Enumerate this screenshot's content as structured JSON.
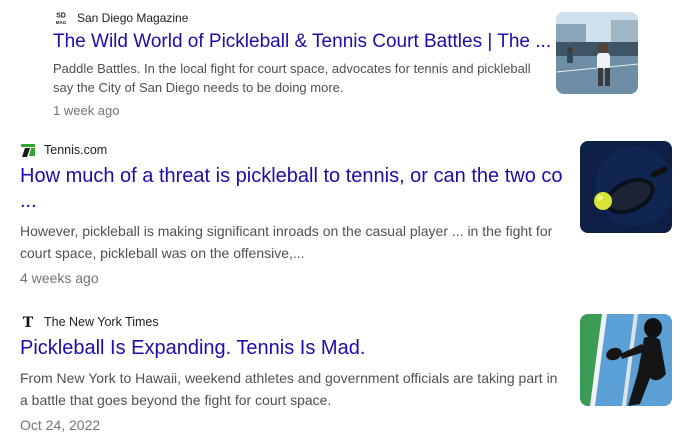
{
  "results": [
    {
      "source": "San Diego Magazine",
      "favicon": "sd-mag-logo-icon",
      "favicon_text": "SD MAG",
      "title": "The Wild World of Pickleball & Tennis Court Battles | The ...",
      "snippet": "Paddle Battles. In the local fight for court space, advocates for tennis and pickleball say the City of San Diego needs to be doing more.",
      "date": "1 week ago",
      "thumbnail": "players-on-court-image"
    },
    {
      "source": "Tennis.com",
      "favicon": "tennis-com-logo-icon",
      "title": "How much of a threat is pickleball to tennis, or can the two co ...",
      "snippet": "However, pickleball is making significant inroads on the casual player ... in the fight for court space, pickleball was on the offensive,...",
      "date": "4 weeks ago",
      "thumbnail": "paddle-and-ball-image"
    },
    {
      "source": "The New York Times",
      "favicon": "nyt-logo-icon",
      "title": "Pickleball Is Expanding. Tennis Is Mad.",
      "snippet": "From New York to Hawaii, weekend athletes and government officials are taking part in a battle that goes beyond the fight for court space.",
      "date": "Oct 24, 2022",
      "thumbnail": "player-shadow-image"
    }
  ],
  "colors": {
    "title_link": "#1a0dab",
    "snippet": "#4d5156",
    "date": "#70757a",
    "tennis_green": "#33a532"
  }
}
